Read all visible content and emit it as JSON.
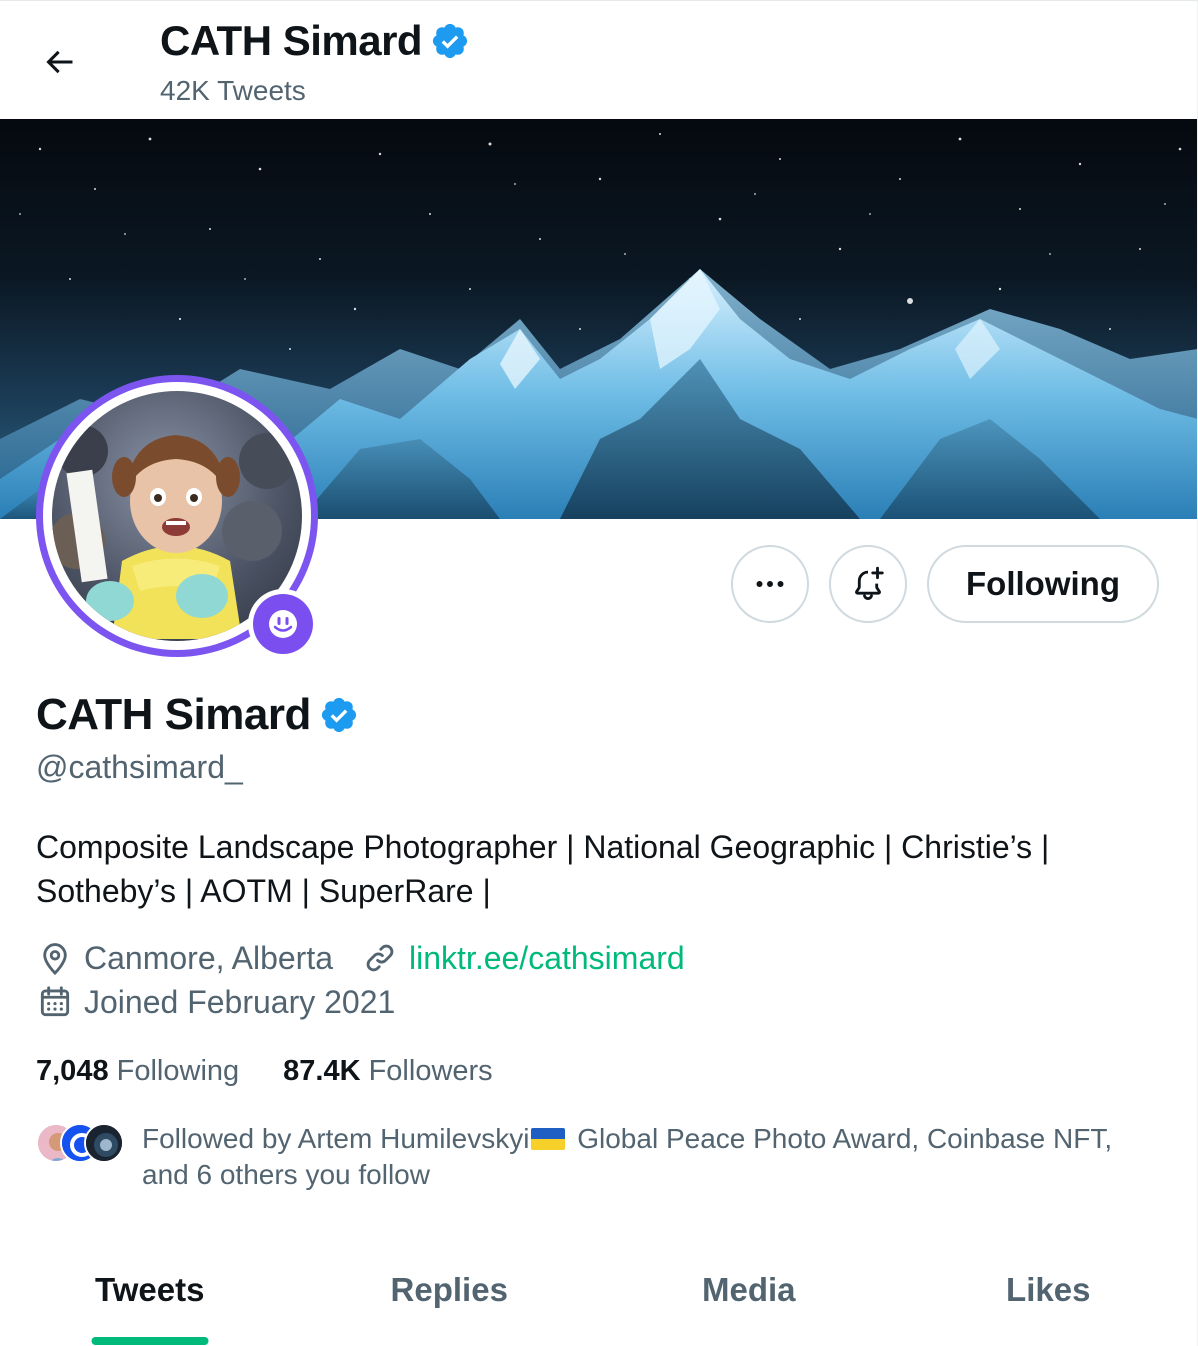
{
  "topbar": {
    "title": "CATH Simard",
    "tweet_count": "42K Tweets"
  },
  "profile": {
    "name": "CATH Simard",
    "handle": "@cathsimard_",
    "bio": "Composite Landscape Photographer | National Geographic | Christie’s | Sotheby’s | AOTM | SuperRare |",
    "location": "Canmore, Alberta",
    "website": "linktr.ee/cathsimard",
    "joined": "Joined February 2021",
    "verified": true
  },
  "actions": {
    "more_icon": "more-horizontal-icon",
    "notify_icon": "bell-plus-icon",
    "following_label": "Following"
  },
  "stats": {
    "following_count": "7,048",
    "following_label": "Following",
    "followers_count": "87.4K",
    "followers_label": "Followers"
  },
  "followed_by": {
    "text_part1": "Followed by Artem Humilevskyi",
    "text_part2": " Global Peace Photo Award, Coinbase NFT, and 6 others you follow"
  },
  "tabs": [
    {
      "label": "Tweets",
      "active": true
    },
    {
      "label": "Replies",
      "active": false
    },
    {
      "label": "Media",
      "active": false
    },
    {
      "label": "Likes",
      "active": false
    }
  ],
  "colors": {
    "accent": "#00ba7c",
    "verified": "#1d9bf0",
    "avatar_ring": "#7c55f0",
    "muted_text": "#536471"
  }
}
